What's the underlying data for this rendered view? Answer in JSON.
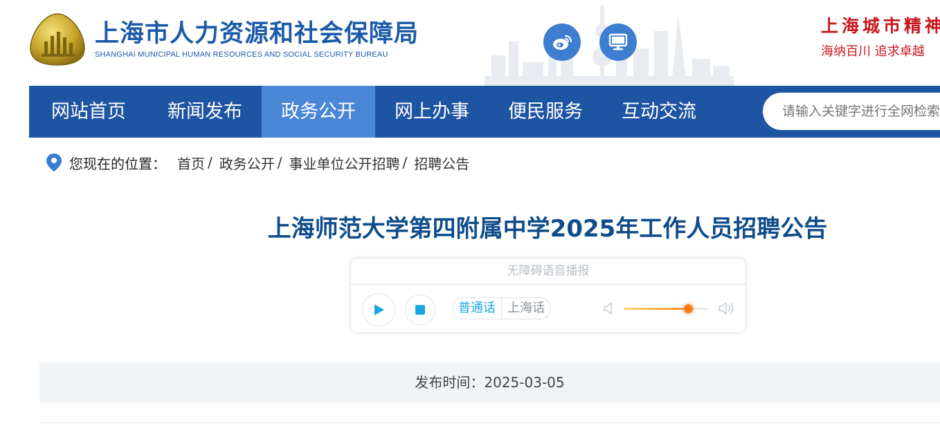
{
  "header": {
    "site_title": "上海市人力资源和社会保障局",
    "site_subtitle": "SHANGHAI MUNICIPAL HUMAN RESOURCES AND SOCIAL SECURITY BUREAU",
    "slogan_line1": "上海城市精神",
    "slogan_line2": "海纳百川  追求卓越",
    "icons": [
      "weibo-icon",
      "desktop-icon"
    ],
    "brand_color": "#1e55a3",
    "slogan_color": "#c8161d"
  },
  "nav": {
    "items": [
      {
        "label": "网站首页"
      },
      {
        "label": "新闻发布"
      },
      {
        "label": "政务公开",
        "active": true
      },
      {
        "label": "网上办事"
      },
      {
        "label": "便民服务"
      },
      {
        "label": "互动交流"
      }
    ],
    "search_placeholder": "请输入关键字进行全网检索"
  },
  "breadcrumb": {
    "label": "您现在的位置：",
    "items": [
      "首页",
      "政务公开",
      "事业单位公开招聘",
      "招聘公告"
    ],
    "separator": "/"
  },
  "article": {
    "title": "上海师范大学第四附属中学2025年工作人员招聘公告",
    "publish_label": "发布时间：",
    "publish_date": "2025-03-05"
  },
  "player": {
    "heading": "无障碍语音播报",
    "lang_options": [
      "普通话",
      "上海话"
    ],
    "selected_lang": "普通话",
    "volume": 0.76,
    "accent_color": "#1ca6e0"
  }
}
